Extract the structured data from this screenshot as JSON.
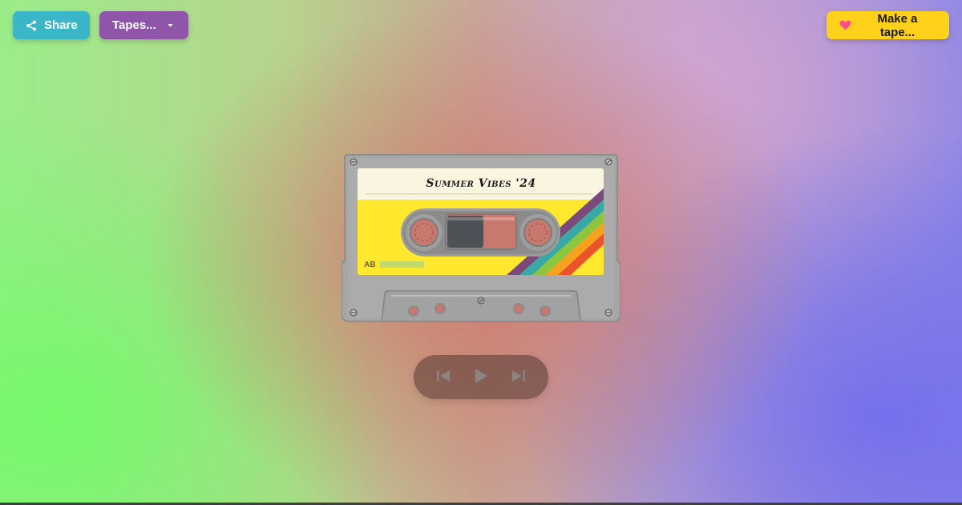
{
  "toolbar": {
    "share_label": "Share",
    "tapes_label": "Tapes...",
    "make_label": "Make a tape..."
  },
  "cassette": {
    "title": "Summer Vibes '24",
    "side_label": "AB"
  },
  "icons": {
    "share": "share-icon",
    "tapes_dropdown": "caret-down-icon",
    "make": "heart-icon",
    "prev": "skip-back-icon",
    "play": "play-icon",
    "next": "skip-forward-icon"
  },
  "colors": {
    "share_button": "#3ab7c7",
    "tapes_button": "#8f55a8",
    "make_button": "#ffd11a",
    "heart": "#ff4f8b",
    "label_yellow": "#ffe82e",
    "label_cream": "#faf5e0",
    "shell_grey": "#a8a8a8",
    "stripes": [
      "#e9542a",
      "#f5a21f",
      "#8cc63f",
      "#39a9a8",
      "#7a4b7a"
    ]
  }
}
